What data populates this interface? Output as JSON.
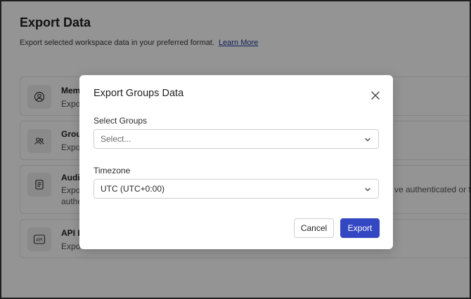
{
  "page": {
    "title": "Export Data",
    "description": "Export selected workspace data in your preferred format.",
    "learn_more": "Learn More"
  },
  "cards": [
    {
      "title": "Mem",
      "desc": "Expo",
      "icon": "user-circle-icon"
    },
    {
      "title": "Grou",
      "desc": "Expo",
      "icon": "users-icon"
    },
    {
      "title": "Audi",
      "desc_line1": "Expo",
      "desc_line2": "authe",
      "desc_right": "ve authenticated or fa",
      "icon": "document-icon"
    },
    {
      "title": "API L",
      "desc": "Expo",
      "icon": "api-icon",
      "icon_text": "API"
    }
  ],
  "modal": {
    "title": "Export Groups Data",
    "groups_label": "Select Groups",
    "groups_placeholder": "Select...",
    "timezone_label": "Timezone",
    "timezone_value": "UTC (UTC+0:00)",
    "cancel_label": "Cancel",
    "export_label": "Export"
  },
  "colors": {
    "primary": "#3447c2",
    "link": "#1d3a9b",
    "overlay": "rgba(0,0,0,0.42)"
  }
}
